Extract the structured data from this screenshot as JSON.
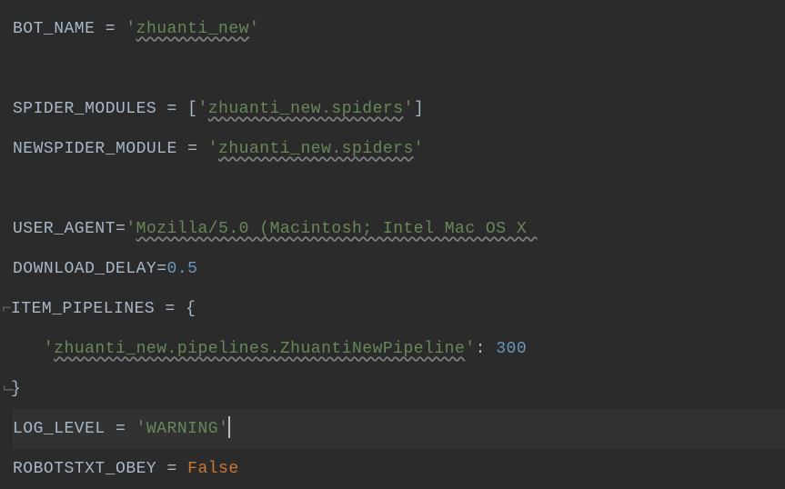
{
  "code": {
    "bot_name_var": "BOT_NAME",
    "bot_name_val": "zhuanti_new",
    "spider_modules_var": "SPIDER_MODULES",
    "spider_modules_val": "zhuanti_new.spiders",
    "newspider_module_var": "NEWSPIDER_MODULE",
    "newspider_module_val": "zhuanti_new.spiders",
    "user_agent_var": "USER_AGENT",
    "user_agent_val": "Mozilla/5.0 (Macintosh; Intel Mac OS X ",
    "download_delay_var": "DOWNLOAD_DELAY",
    "download_delay_val": "0.5",
    "item_pipelines_var": "ITEM_PIPELINES",
    "pipeline_key": "zhuanti_new.pipelines.ZhuantiNewPipeline",
    "pipeline_val": "300",
    "log_level_var": "LOG_LEVEL",
    "log_level_val": "WARNING",
    "robotstxt_var": "ROBOTSTXT_OBEY",
    "robotstxt_val": "False"
  },
  "sym": {
    "eq": " = ",
    "eq_tight": "=",
    "q": "'",
    "lbr": "[",
    "rbr": "]",
    "lcb": "{",
    "rcb": "}",
    "colon_sp": ": ",
    "indent": "   "
  }
}
